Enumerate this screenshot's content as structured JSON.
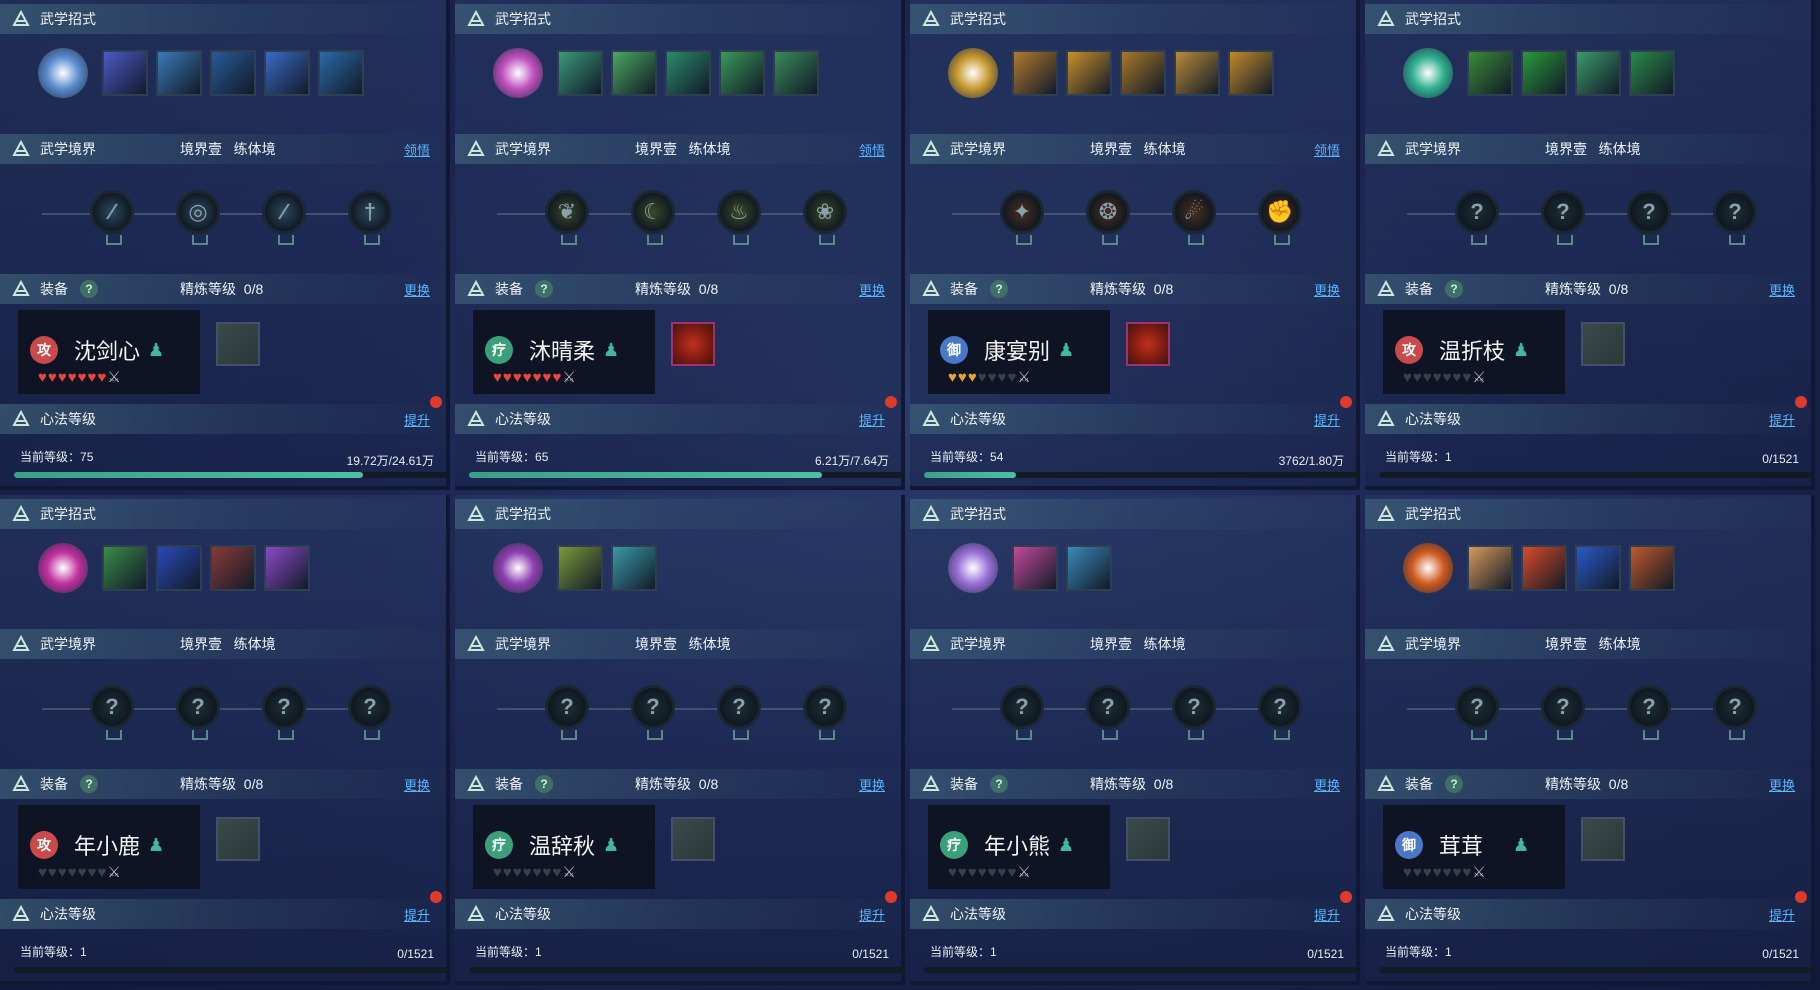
{
  "labels": {
    "skills": "武学招式",
    "realm": "武学境界",
    "realm_stage": "境界壹",
    "realm_type": "练体境",
    "enlighten": "领悟",
    "equip": "装备",
    "refine": "精炼等级",
    "refine_value": "0/8",
    "swap": "更换",
    "xinfa": "心法等级",
    "upgrade": "提升",
    "current_level": "当前等级："
  },
  "colors": {
    "attack_badge": "#c94a4a",
    "heal_badge": "#3aa07a",
    "defend_badge": "#4a78c8",
    "heart_red": "#e8483a",
    "heart_gold": "#e8a32c",
    "heart_empty": "#3a3f4a",
    "progress": "#4fc0a0",
    "link": "#58b6ff"
  },
  "panels": [
    {
      "name": "沈剑心",
      "role": "攻",
      "role_type": "attack",
      "hearts": 7,
      "heart_color": "red",
      "level": "75",
      "exp": "19.72万/24.61万",
      "progress": 0.8,
      "show_enlighten": true,
      "has_gear": false,
      "skill_main": "#5b8ccf",
      "skill_colors": [
        "#4a5ac8",
        "#3a7ab8",
        "#2a5a98",
        "#3a6ac8",
        "#2a6aa8"
      ],
      "node_colors": [
        "#2c4a60",
        "#2c4a60",
        "#2c4a60",
        "#2c4a60"
      ],
      "node_glyphs": [
        "∕",
        "◎",
        "∕",
        "†"
      ]
    },
    {
      "name": "沐晴柔",
      "role": "疗",
      "role_type": "heal",
      "hearts": 7,
      "heart_color": "red",
      "level": "65",
      "exp": "6.21万/7.64万",
      "progress": 0.81,
      "show_enlighten": true,
      "has_gear": true,
      "skill_main": "#c050c0",
      "skill_colors": [
        "#3a9a7a",
        "#4aa860",
        "#2a8a6a",
        "#3a9a5a",
        "#3a8a5a"
      ],
      "node_colors": [
        "#3a4a2a",
        "#3a4a2a",
        "#3a4a2a",
        "#3a4a2a"
      ],
      "node_glyphs": [
        "❦",
        "☾",
        "♨",
        "❀"
      ]
    },
    {
      "name": "康宴别",
      "role": "御",
      "role_type": "defend",
      "hearts": 3,
      "heart_color": "gold",
      "level": "54",
      "exp": "3762/1.80万",
      "progress": 0.21,
      "show_enlighten": true,
      "has_gear": true,
      "skill_main": "#c89a30",
      "skill_colors": [
        "#b07a30",
        "#c8902a",
        "#a8782a",
        "#b88a3a",
        "#c08a2a"
      ],
      "node_colors": [
        "#4a3020",
        "#4a3020",
        "#4a3020",
        "#4a3020"
      ],
      "node_glyphs": [
        "✦",
        "❂",
        "☄",
        "✊"
      ]
    },
    {
      "name": "温折枝",
      "role": "攻",
      "role_type": "attack",
      "hearts": 0,
      "heart_color": "red",
      "level": "1",
      "exp": "0/1521",
      "progress": 0,
      "show_enlighten": false,
      "has_gear": false,
      "skill_main": "#30b090",
      "skill_colors": [
        "#3a8a3a",
        "#2a9a3a",
        "#3a9a6a",
        "#2a8a4a"
      ],
      "node_colors": [
        "#1e2e34",
        "#1e2e34",
        "#1e2e34",
        "#1e2e34"
      ],
      "node_glyphs": [
        "?",
        "?",
        "?",
        "?"
      ]
    },
    {
      "name": "年小鹿",
      "role": "攻",
      "role_type": "attack",
      "hearts": 0,
      "heart_color": "red",
      "level": "1",
      "exp": "0/1521",
      "progress": 0,
      "show_enlighten": false,
      "has_gear": false,
      "skill_main": "#c030a0",
      "skill_colors": [
        "#3a8a4a",
        "#2a4ab8",
        "#8a3a3a",
        "#8a4ac8"
      ],
      "node_colors": [
        "#1e2e34",
        "#1e2e34",
        "#1e2e34",
        "#1e2e34"
      ],
      "node_glyphs": [
        "?",
        "?",
        "?",
        "?"
      ]
    },
    {
      "name": "温辞秋",
      "role": "疗",
      "role_type": "heal",
      "hearts": 0,
      "heart_color": "red",
      "level": "1",
      "exp": "0/1521",
      "progress": 0,
      "show_enlighten": false,
      "has_gear": false,
      "skill_main": "#9040b0",
      "skill_colors": [
        "#7a9a3a",
        "#3a9aa8"
      ],
      "node_colors": [
        "#1e2e34",
        "#1e2e34",
        "#1e2e34",
        "#1e2e34"
      ],
      "node_glyphs": [
        "?",
        "?",
        "?",
        "?"
      ]
    },
    {
      "name": "年小熊",
      "role": "疗",
      "role_type": "heal",
      "hearts": 0,
      "heart_color": "red",
      "level": "1",
      "exp": "0/1521",
      "progress": 0,
      "show_enlighten": false,
      "has_gear": false,
      "skill_main": "#9a70d8",
      "skill_colors": [
        "#c04a9a",
        "#3a8ab8"
      ],
      "node_colors": [
        "#1e2e34",
        "#1e2e34",
        "#1e2e34",
        "#1e2e34"
      ],
      "node_glyphs": [
        "?",
        "?",
        "?",
        "?"
      ]
    },
    {
      "name": "茸茸",
      "role": "御",
      "role_type": "defend",
      "hearts": 0,
      "heart_color": "red",
      "level": "1",
      "exp": "0/1521",
      "progress": 0,
      "show_enlighten": false,
      "has_gear": false,
      "skill_main": "#d05a20",
      "skill_colors": [
        "#d89a5a",
        "#d84a2a",
        "#2a5ac8",
        "#c05a2a"
      ],
      "node_colors": [
        "#1e2e34",
        "#1e2e34",
        "#1e2e34",
        "#1e2e34"
      ],
      "node_glyphs": [
        "?",
        "?",
        "?",
        "?"
      ]
    }
  ]
}
